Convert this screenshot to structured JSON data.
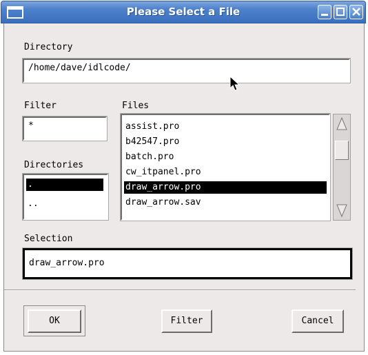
{
  "window": {
    "title": "Please Select a File",
    "title_icon": "window-menu-icon",
    "controls": [
      "minimize-icon",
      "maximize-icon",
      "close-icon"
    ]
  },
  "directory": {
    "label": "Directory",
    "value": "/home/dave/idlcode/"
  },
  "filter": {
    "label": "Filter",
    "value": "*"
  },
  "files": {
    "label": "Files",
    "items": [
      "assist.pro",
      "b42547.pro",
      "batch.pro",
      "cw_itpanel.pro",
      "draw_arrow.pro",
      "draw_arrow.sav"
    ],
    "selected": "draw_arrow.pro"
  },
  "directories": {
    "label": "Directories",
    "items": [
      ".",
      ".."
    ],
    "selected": "."
  },
  "selection": {
    "label": "Selection",
    "value": "draw_arrow.pro"
  },
  "buttons": {
    "ok": "OK",
    "filter": "Filter",
    "cancel": "Cancel"
  },
  "colors": {
    "titlebar": "#3a6fbd",
    "dialog_bg": "#ece9e8",
    "selection_bg": "#000000"
  }
}
